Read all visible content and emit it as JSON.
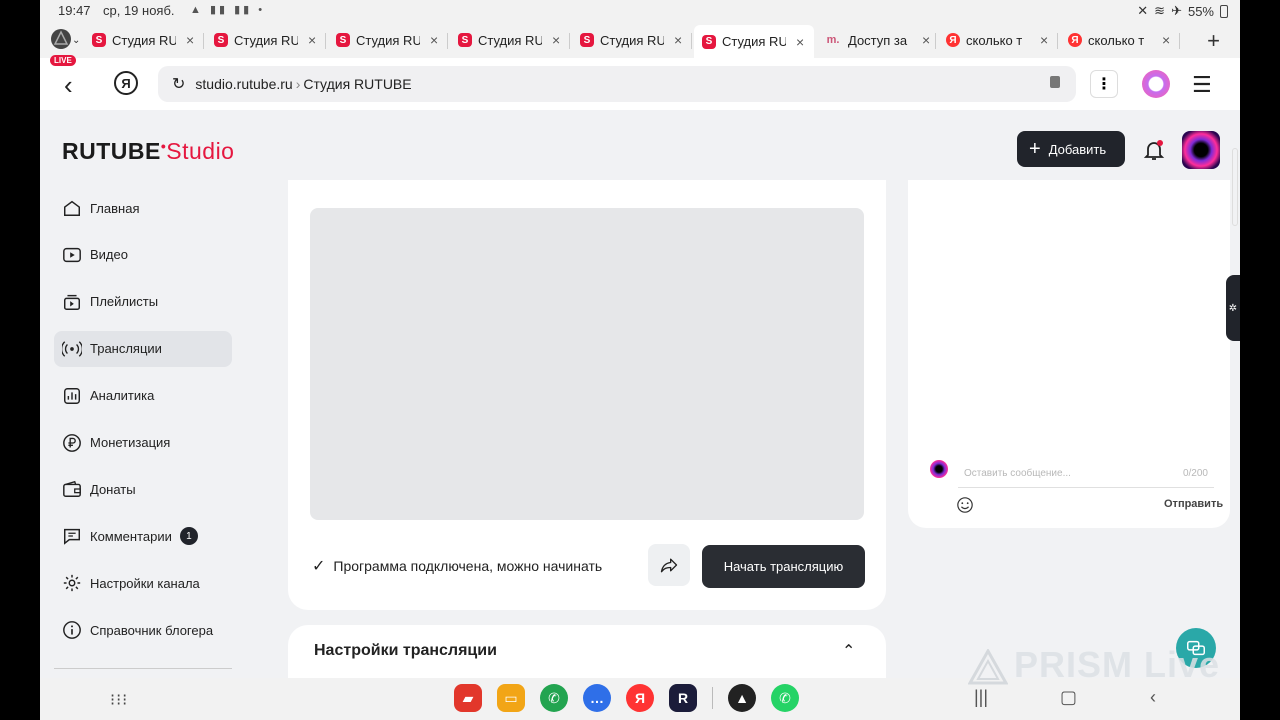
{
  "statusbar": {
    "time": "19:47",
    "date": "ср, 19 нояб.",
    "battery": "55%"
  },
  "tabs": {
    "live_badge": "LIVE",
    "items": [
      {
        "label": "Студия RU",
        "icon": "rutube-icon",
        "favicon": "S"
      },
      {
        "label": "Студия RU",
        "icon": "rutube-icon",
        "favicon": "S"
      },
      {
        "label": "Студия RU",
        "icon": "rutube-icon",
        "favicon": "S"
      },
      {
        "label": "Студия RU",
        "icon": "rutube-icon",
        "favicon": "S"
      },
      {
        "label": "Студия RU",
        "icon": "rutube-icon",
        "favicon": "S"
      },
      {
        "label": "Студия RU",
        "icon": "rutube-icon",
        "favicon": "S",
        "active": true
      },
      {
        "label": "Доступ за",
        "icon": "m-icon",
        "favicon": "m."
      },
      {
        "label": "сколько т",
        "icon": "yandex-icon",
        "favicon": "Я"
      },
      {
        "label": "сколько т",
        "icon": "yandex-icon",
        "favicon": "Я"
      }
    ]
  },
  "addressbar": {
    "url": "studio.rutube.ru",
    "separator": "›",
    "page_title": "Студия RUTUBE"
  },
  "header": {
    "logo_main": "RUTUBE",
    "logo_studio": "Studio",
    "add_label": "Добавить"
  },
  "sidebar": {
    "items": [
      {
        "label": "Главная",
        "icon": "home-icon"
      },
      {
        "label": "Видео",
        "icon": "video-icon"
      },
      {
        "label": "Плейлисты",
        "icon": "playlist-icon"
      },
      {
        "label": "Трансляции",
        "icon": "broadcast-icon",
        "active": true
      },
      {
        "label": "Аналитика",
        "icon": "analytics-icon"
      },
      {
        "label": "Монетизация",
        "icon": "ruble-icon"
      },
      {
        "label": "Донаты",
        "icon": "wallet-icon"
      },
      {
        "label": "Комментарии",
        "icon": "comment-icon",
        "badge": "1"
      },
      {
        "label": "Настройки канала",
        "icon": "gear-icon"
      },
      {
        "label": "Справочник блогера",
        "icon": "info-icon"
      }
    ]
  },
  "main": {
    "status_text": "Программа подключена, можно начинать",
    "start_label": "Начать трансляцию",
    "settings_title": "Настройки трансляции"
  },
  "chat": {
    "placeholder": "Оставить сообщение...",
    "counter": "0/200",
    "send_label": "Отправить"
  },
  "watermark": "PRISM Live",
  "colors": {
    "brand": "#e5173f",
    "dark_button": "#21242b"
  }
}
